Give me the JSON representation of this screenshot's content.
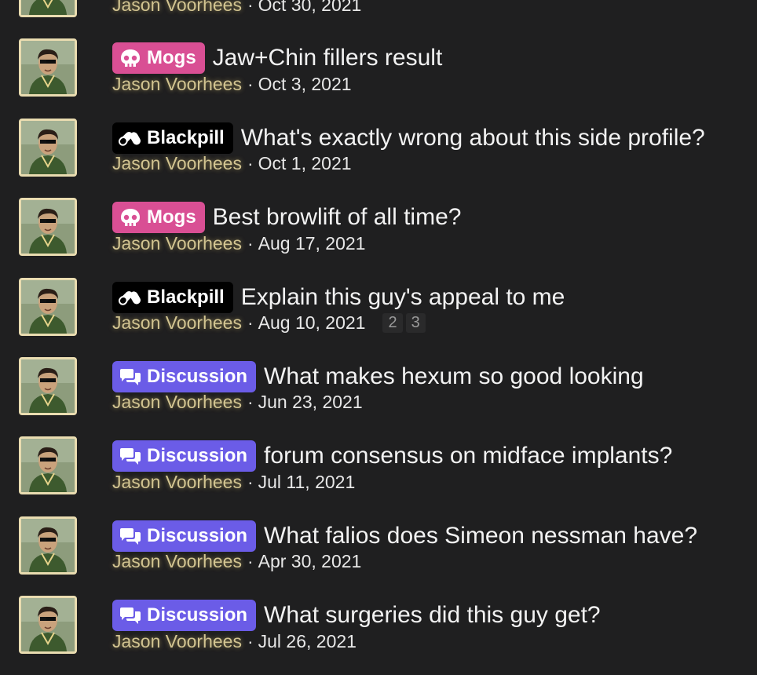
{
  "threads": [
    {
      "prefix": "",
      "prefix_type": "none",
      "title": "",
      "author": "Jason Voorhees",
      "separator": "·",
      "date": "Oct 30, 2021",
      "pages": []
    },
    {
      "prefix": "Mogs",
      "prefix_type": "mogs",
      "title": "Jaw+Chin fillers result",
      "author": "Jason Voorhees",
      "separator": "·",
      "date": "Oct 3, 2021",
      "pages": []
    },
    {
      "prefix": "Blackpill",
      "prefix_type": "blackpill",
      "title": "What's exactly wrong about this side profile?",
      "author": "Jason Voorhees",
      "separator": "·",
      "date": "Oct 1, 2021",
      "pages": []
    },
    {
      "prefix": "Mogs",
      "prefix_type": "mogs",
      "title": "Best browlift of all time?",
      "author": "Jason Voorhees",
      "separator": "·",
      "date": "Aug 17, 2021",
      "pages": []
    },
    {
      "prefix": "Blackpill",
      "prefix_type": "blackpill",
      "title": "Explain this guy's appeal to me",
      "author": "Jason Voorhees",
      "separator": "·",
      "date": "Aug 10, 2021",
      "pages": [
        "2",
        "3"
      ]
    },
    {
      "prefix": "Discussion",
      "prefix_type": "discussion",
      "title": "What makes hexum so good looking",
      "author": "Jason Voorhees",
      "separator": "·",
      "date": "Jun 23, 2021",
      "pages": []
    },
    {
      "prefix": "Discussion",
      "prefix_type": "discussion",
      "title": "forum consensus on midface implants?",
      "author": "Jason Voorhees",
      "separator": "·",
      "date": "Jul 11, 2021",
      "pages": []
    },
    {
      "prefix": "Discussion",
      "prefix_type": "discussion",
      "title": "What falios does Simeon nessman have?",
      "author": "Jason Voorhees",
      "separator": "·",
      "date": "Apr 30, 2021",
      "pages": []
    },
    {
      "prefix": "Discussion",
      "prefix_type": "discussion",
      "title": "What surgeries did this guy get?",
      "author": "Jason Voorhees",
      "separator": "·",
      "date": "Jul 26, 2021",
      "pages": []
    }
  ],
  "prefix_icons": {
    "mogs": "skull-icon",
    "blackpill": "pill-icon",
    "discussion": "chat-bubbles-icon"
  },
  "colors": {
    "mogs": "#d94f94",
    "blackpill": "#000000",
    "discussion": "#6b5ce7",
    "author": "#d2c491",
    "background": "#1f1f20",
    "avatar_border": "#e9dcb0"
  }
}
